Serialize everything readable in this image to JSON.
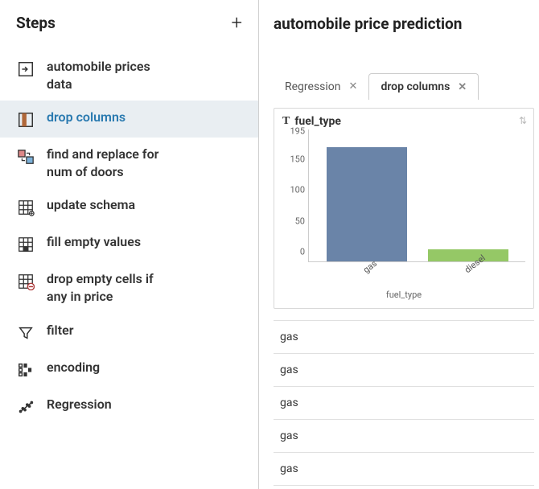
{
  "sidebar": {
    "title": "Steps",
    "items": [
      {
        "label": "automobile prices data"
      },
      {
        "label": "drop columns"
      },
      {
        "label": "find and replace for num of doors"
      },
      {
        "label": "update schema"
      },
      {
        "label": "fill empty values"
      },
      {
        "label": "drop empty cells if any in price"
      },
      {
        "label": "filter"
      },
      {
        "label": "encoding"
      },
      {
        "label": "Regression"
      }
    ]
  },
  "main": {
    "title": "automobile price prediction",
    "tabs": [
      {
        "label": "Regression"
      },
      {
        "label": "drop columns"
      }
    ],
    "column_header": "fuel_type",
    "rows": [
      "gas",
      "gas",
      "gas",
      "gas",
      "gas"
    ]
  },
  "chart_data": {
    "type": "bar",
    "title": "fuel_type",
    "xlabel": "fuel_type",
    "ylabel": "",
    "ylim": [
      0,
      195
    ],
    "y_ticks": [
      0,
      50,
      100,
      150,
      195
    ],
    "categories": [
      "gas",
      "diesel"
    ],
    "values": [
      185,
      20
    ],
    "colors": {
      "gas": "#6a84a8",
      "diesel": "#95c866"
    }
  }
}
